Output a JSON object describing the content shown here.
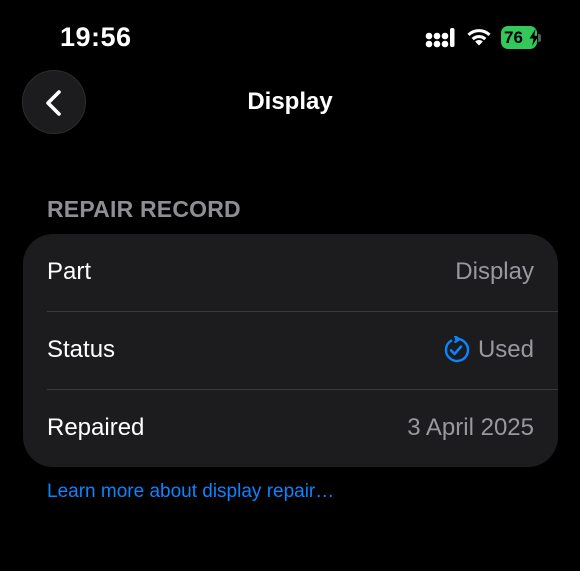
{
  "status_bar": {
    "time": "19:56",
    "battery_level": "76",
    "battery_color": "#34c759",
    "icons": [
      "signal-icon",
      "wifi-icon",
      "battery-icon",
      "charging-bolt-icon"
    ]
  },
  "nav": {
    "title": "Display",
    "back_icon": "chevron-left-icon"
  },
  "section": {
    "header": "REPAIR RECORD"
  },
  "rows": [
    {
      "label": "Part",
      "value": "Display"
    },
    {
      "label": "Status",
      "value": "Used",
      "icon": "circular-checkmark-icon",
      "icon_color": "#0a84ff"
    },
    {
      "label": "Repaired",
      "value": "3 April 2025"
    }
  ],
  "footer": {
    "link_text": "Learn more about display repair…",
    "link_color": "#0a84ff"
  }
}
